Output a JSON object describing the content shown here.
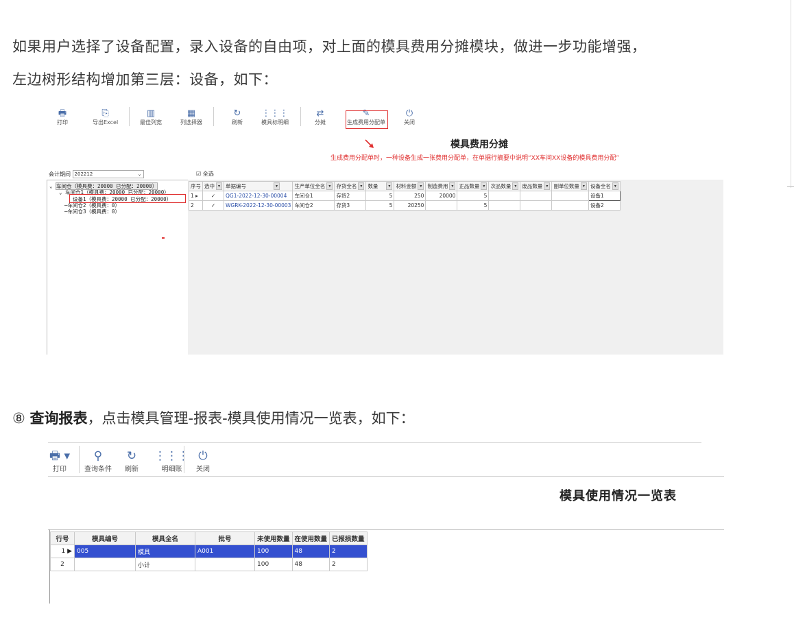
{
  "intro": {
    "line1": "如果用户选择了设备配置，录入设备的自由项，对上面的模具费用分摊模块，做进一步功能增强，",
    "line2": "左边树形结构增加第三层：设备，如下："
  },
  "shot1": {
    "toolbar": [
      {
        "icon": "printer-icon",
        "glyph": "🖶",
        "label": "打印"
      },
      {
        "icon": "export-excel-icon",
        "glyph": "⎘",
        "label": "导出Excel"
      },
      {
        "icon": "best-columns-icon",
        "glyph": "▥",
        "label": "最佳列宽"
      },
      {
        "icon": "column-selector-icon",
        "glyph": "▦",
        "label": "列选择器"
      },
      {
        "icon": "refresh-icon",
        "glyph": "↻",
        "label": "刷新"
      },
      {
        "icon": "detail-grid-icon",
        "glyph": "⋮⋮⋮",
        "label": "模具标明细"
      },
      {
        "icon": "allocate-icon",
        "glyph": "⇄",
        "label": "分摊"
      },
      {
        "icon": "edit-icon",
        "glyph": "✎",
        "label": "生成费用分配单"
      },
      {
        "icon": "power-icon",
        "glyph": "⏻",
        "label": "关闭"
      }
    ],
    "title": "模具费用分摊",
    "annotation": "生成费用分配单时，一种设备生成一张费用分配单，在单据行摘要中说明“XX车间XX设备的模具费用分配”",
    "period_label": "会计期间",
    "period_value": "202212",
    "select_all": "全选",
    "tree": [
      "车间仓（模具费：20000 已分配：20000）",
      "车间仓1（模具费：20000 已分配：20000）",
      "设备1（模具费：20000 已分配：20000）",
      "车间仓2（模具费：0）",
      "车间仓3（模具费：0）"
    ],
    "columns": [
      "序号",
      "选中",
      "单据编号",
      "生产单位全名",
      "存货全名",
      "数量",
      "材料金额",
      "制造费用",
      "正品数量",
      "次品数量",
      "废品数量",
      "副单位数量",
      "设备全名"
    ],
    "rows": [
      [
        "1",
        "✓",
        "QG1-2022-12-30-00004",
        "车间仓1",
        "存货2",
        "5",
        "250",
        "20000",
        "5",
        "",
        "",
        "",
        "设备1"
      ],
      [
        "2",
        "✓",
        "WGRK-2022-12-30-00003",
        "车间仓2",
        "存货3",
        "5",
        "20250",
        "",
        "5",
        "",
        "",
        "",
        "设备2"
      ]
    ]
  },
  "section8": {
    "num": "⑧",
    "bold": "查询报表",
    "rest": "，点击模具管理-报表-模具使用情况一览表，如下："
  },
  "shot2": {
    "toolbar": [
      {
        "icon": "printer-icon",
        "glyph": "🖶 ▾",
        "label": "打印"
      },
      {
        "icon": "search-icon",
        "glyph": "⚲",
        "label": "查询条件"
      },
      {
        "icon": "refresh-icon",
        "glyph": "↻",
        "label": "刷新"
      },
      {
        "icon": "detail-ledger-icon",
        "glyph": "⋮⋮⋮",
        "label": "明细账"
      },
      {
        "icon": "power-icon",
        "glyph": "⏻",
        "label": "关闭"
      }
    ],
    "title": "模具使用情况一览表",
    "columns": [
      "行号",
      "模具编号",
      "模具全名",
      "批号",
      "未使用数量",
      "在使用数量",
      "已报损数量"
    ],
    "rows": [
      [
        "1",
        "005",
        "模具",
        "A001",
        "100",
        "48",
        "2"
      ],
      [
        "2",
        "",
        "小计",
        "",
        "100",
        "48",
        "2"
      ]
    ]
  }
}
